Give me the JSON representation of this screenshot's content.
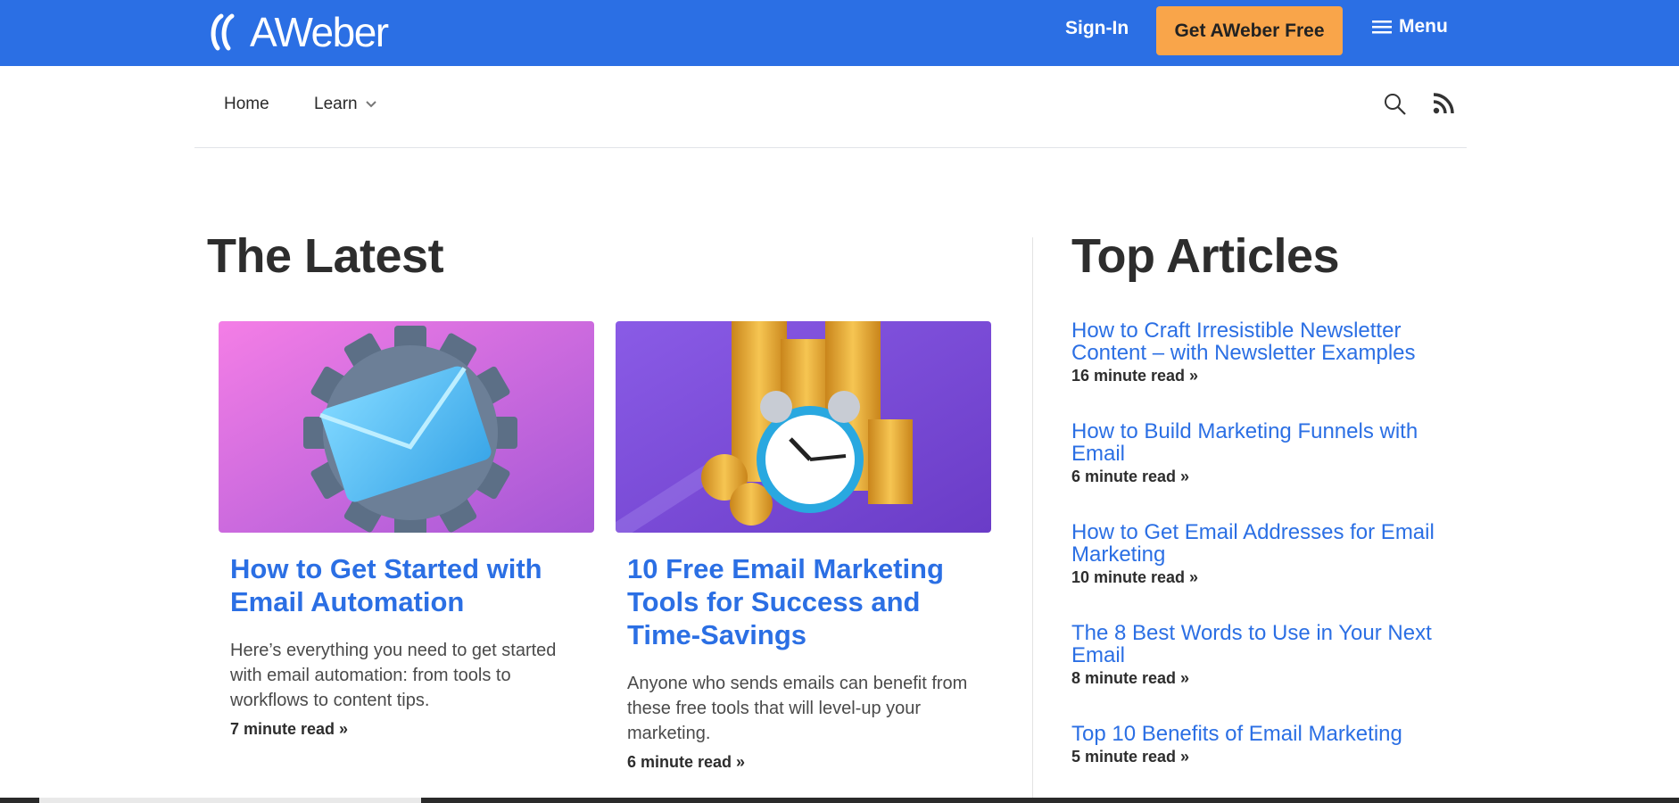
{
  "brand": {
    "name": "AWeber",
    "color": "#2b6fe4",
    "cta_color": "#f9a54a"
  },
  "header": {
    "signin_label": "Sign-In",
    "cta_label": "Get AWeber Free",
    "menu_label": "Menu",
    "menu_icon": "hamburger-icon"
  },
  "subnav": {
    "home_label": "Home",
    "learn_label": "Learn",
    "learn_icon": "chevron-down-icon",
    "search_icon": "search-icon",
    "rss_icon": "rss-icon"
  },
  "latest": {
    "heading": "The Latest",
    "cards": [
      {
        "image": "email-gear-illustration",
        "title": "How to Get Started with Email Automation",
        "description": "Here’s everything you need to get started with email automation: from tools to workflows to content tips.",
        "read": "7 minute read »"
      },
      {
        "image": "alarm-clock-coins-illustration",
        "title": "10 Free Email Marketing Tools for Success and Time-Savings",
        "description": "Anyone who sends emails can benefit from these free tools that will level-up your marketing.",
        "read": "6 minute read »"
      }
    ]
  },
  "top_articles": {
    "heading": "Top Articles",
    "items": [
      {
        "title": "How to Craft Irresistible Newsletter Content – with Newsletter Examples",
        "read": "16 minute read »"
      },
      {
        "title": "How to Build Marketing Funnels with Email",
        "read": "6 minute read »"
      },
      {
        "title": "How to Get Email Addresses for Email Marketing",
        "read": "10 minute read »"
      },
      {
        "title": "The 8 Best Words to Use in Your Next Email",
        "read": "8 minute read »"
      },
      {
        "title": "Top 10 Benefits of Email Marketing",
        "read": "5 minute read »"
      }
    ]
  }
}
